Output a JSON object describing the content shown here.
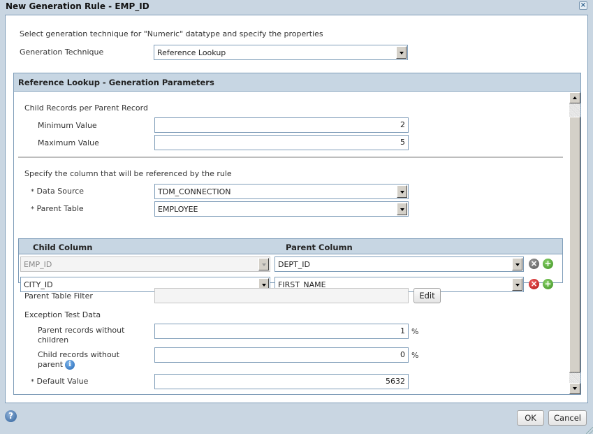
{
  "dialog": {
    "title": "New Generation Rule - EMP_ID",
    "close_icon": "close-icon"
  },
  "intro_text": "Select generation technique for \"Numeric\" datatype and specify the properties",
  "generation_technique": {
    "label": "Generation Technique",
    "value": "Reference Lookup"
  },
  "panel": {
    "title": "Reference Lookup - Generation Parameters",
    "child_records": {
      "heading": "Child Records per Parent Record",
      "min_label": "Minimum Value",
      "min_value": "2",
      "max_label": "Maximum Value",
      "max_value": "5"
    },
    "reference": {
      "heading": "Specify the column that will be referenced by the rule",
      "required_marker": "*",
      "data_source_label": "Data Source",
      "data_source_value": "TDM_CONNECTION",
      "parent_table_label": "Parent Table",
      "parent_table_value": "EMPLOYEE"
    },
    "column_grid": {
      "headers": [
        "Child Column",
        "Parent Column"
      ],
      "rows": [
        {
          "child": "EMP_ID",
          "parent": "DEPT_ID",
          "child_disabled": true,
          "remove_enabled": false
        },
        {
          "child": "CITY_ID",
          "parent": "FIRST_NAME",
          "child_disabled": false,
          "remove_enabled": true
        }
      ]
    },
    "filter": {
      "label": "Parent Table Filter",
      "value": "",
      "edit_label": "Edit"
    },
    "exception": {
      "heading": "Exception Test Data",
      "parent_without_children_label_1": "Parent records without",
      "parent_without_children_label_2": "children",
      "parent_without_children_value": "1",
      "child_without_parent_label_1": "Child records without",
      "child_without_parent_label_2": "parent",
      "child_without_parent_value": "0",
      "percent": "%",
      "default_value_label": "Default Value",
      "default_value": "5632"
    }
  },
  "footer": {
    "ok_label": "OK",
    "cancel_label": "Cancel",
    "help_glyph": "?",
    "info_glyph": "i"
  },
  "icons": {
    "remove_glyph": "×",
    "add_glyph": "+",
    "close_glyph": "×"
  }
}
